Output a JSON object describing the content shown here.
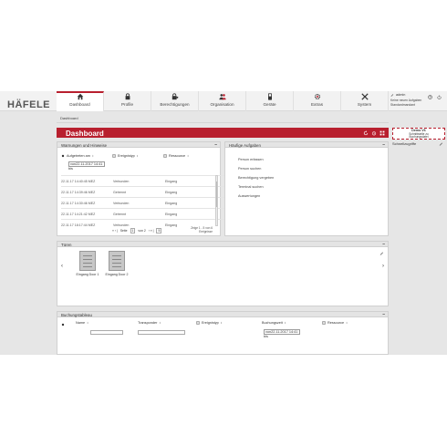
{
  "brand": {
    "logo_text": "HÄFELE",
    "accent_color": "#b81f2e"
  },
  "nav": [
    {
      "label": "Dashboard",
      "icon": "home-icon",
      "active": true
    },
    {
      "label": "Profile",
      "icon": "lock-icon"
    },
    {
      "label": "Berechtigungen",
      "icon": "key-lock-icon"
    },
    {
      "label": "Organisation",
      "icon": "people-icon"
    },
    {
      "label": "Geräte",
      "icon": "device-icon"
    },
    {
      "label": "Extras",
      "icon": "gear-icon"
    },
    {
      "label": "System",
      "icon": "tools-icon"
    }
  ],
  "user": {
    "name": "admin",
    "line2": "Keine neuen Aufgaben",
    "line3": "Standardmandant"
  },
  "breadcrumb": "Dashboard",
  "page_title": "Dashboard",
  "side_note": {
    "line1": "Demo V6",
    "line2": "Schnittstelle zu",
    "line3": "Buchungsdatei"
  },
  "quick_links": "Schnellzugriffe",
  "warnings": {
    "title": "Warnungen und Hinweise",
    "filter_date_label": "Aufgetreten am",
    "filter_event_label": "Ereignistyp",
    "filter_resource_label": "Ressource",
    "date_value": "von22.11.2017 14:41",
    "bis_label": "bis",
    "rows": [
      {
        "time": "22.11.17 14:40:45 MEZ",
        "event": "Verbunden",
        "resource": "Eingang"
      },
      {
        "time": "22.11.17 14:39:46 MEZ",
        "event": "Getrennt",
        "resource": "Eingang"
      },
      {
        "time": "22.11.17 14:30:46 MEZ",
        "event": "Verbunden",
        "resource": "Eingang"
      },
      {
        "time": "22.11.17 14:21:42 MEZ",
        "event": "Getrennt",
        "resource": "Eingang"
      },
      {
        "time": "22.11.17 18:17:44 MEZ",
        "event": "Verbunden",
        "resource": "Eingang"
      }
    ],
    "pager_prev": "« ‹ |",
    "pager_page_label": "Seite",
    "pager_page": "1",
    "pager_of": "von 2",
    "pager_next": "› » |",
    "pager_size": "5",
    "info_line1": "Zeige 1 - 5 von 6",
    "info_line2": "Ereignisse"
  },
  "tasks": {
    "title": "Häufige Aufgaben",
    "items": [
      "Person erfassen",
      "Person suchen",
      "Berechtigung vergeben",
      "Terminal suchen",
      "Auswertungen"
    ]
  },
  "doors": {
    "title": "Türen",
    "items": [
      "Eingang Door 1",
      "Eingang Door 2"
    ],
    "prev": "‹",
    "next": "›"
  },
  "bookings": {
    "title": "Buchungstableau",
    "col_name": "Name",
    "col_transponder": "Transponder",
    "col_event": "Ereignistyp",
    "col_time": "Buchungszeit",
    "col_resource": "Ressource",
    "date_value": "von22.11.2017 14:41",
    "bis_label": "bis"
  },
  "sort_glyph": "↕",
  "minimize_glyph": "–"
}
